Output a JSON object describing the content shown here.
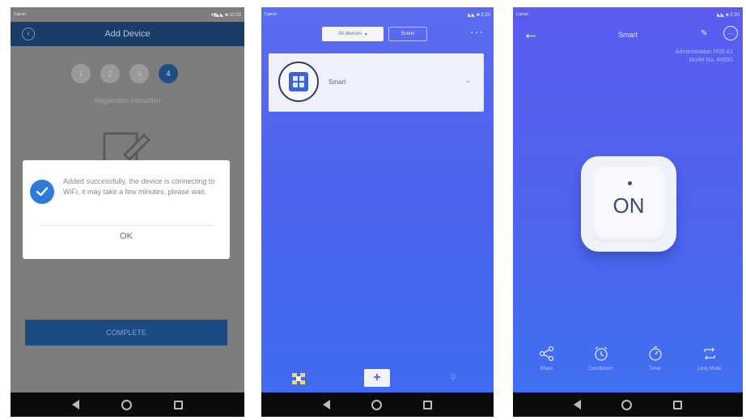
{
  "screen1": {
    "status": {
      "left": "Carrier",
      "right": "▾▮◣◣ ■ 11:01"
    },
    "header_title": "Add Device",
    "back_icon": "back-circle-icon",
    "steps": [
      "1",
      "2",
      "3",
      "4"
    ],
    "active_step": 4,
    "step_caption": "Registration instruction",
    "dialog": {
      "message": "Added successfully, the device is connecting to WiFi, it may take a few minutes, please wait.",
      "ok_label": "OK",
      "icon": "check-circle-icon"
    },
    "complete_label": "COMPLETE",
    "colors": {
      "header": "#1a3d68",
      "overlay": "#7d7d7d",
      "accent": "#2f7bdb"
    }
  },
  "screen2": {
    "status": {
      "left": "Carrier",
      "right": "◣◣ ■ 2:20"
    },
    "filter_label": "All devices",
    "scene_label": "Scene",
    "more_icon": "more-icon",
    "device": {
      "name": "Smart",
      "icon": "switch-device-icon",
      "chevron": "⌄"
    },
    "tabs": [
      {
        "icon": "devices-grid-icon",
        "active": true
      },
      {
        "label": "+",
        "icon": "add-device-icon"
      },
      {
        "icon": "profile-icon"
      }
    ],
    "colors": {
      "background_top": "#5b6cf0",
      "background_bottom": "#3f6cf2"
    }
  },
  "screen3": {
    "status": {
      "left": "Carrier",
      "right": "◣◣ ■ 2:20"
    },
    "title": "Smart",
    "back_icon": "arrow-left-icon",
    "edit_icon": "pencil-icon",
    "info_icon": "ellipsis-circle-icon",
    "subtitle_lines": [
      "Administration Ｍ00 A1",
      "Model No. 4495D"
    ],
    "power_label": "ON",
    "power_state": "on",
    "tools": [
      {
        "label": "Share",
        "icon": "share-icon"
      },
      {
        "label": "Countdown",
        "icon": "alarm-clock-icon"
      },
      {
        "label": "Timer",
        "icon": "stopwatch-icon"
      },
      {
        "label": "Loop Mode",
        "icon": "loop-icon"
      }
    ]
  }
}
